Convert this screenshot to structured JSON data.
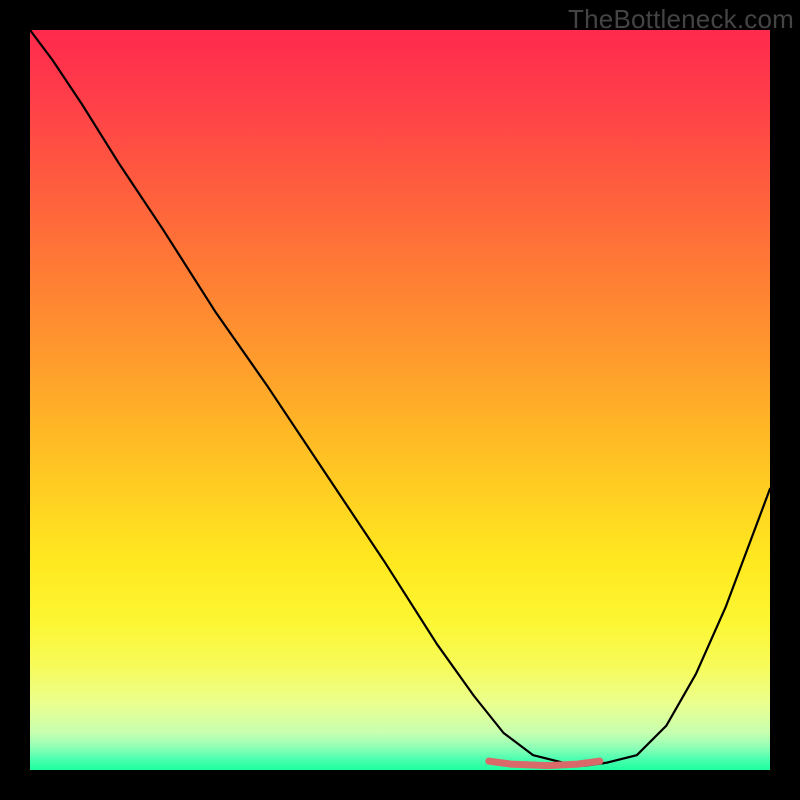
{
  "watermark": "TheBottleneck.com",
  "chart_data": {
    "type": "line",
    "title": "",
    "xlabel": "",
    "ylabel": "",
    "xlim": [
      0,
      100
    ],
    "ylim": [
      0,
      100
    ],
    "grid": false,
    "series": [
      {
        "name": "black-curve",
        "x": [
          0,
          3,
          7,
          12,
          18,
          25,
          32,
          40,
          48,
          55,
          60,
          64,
          68,
          72,
          75,
          78,
          82,
          86,
          90,
          94,
          97,
          100
        ],
        "y": [
          100,
          96,
          90,
          82,
          73,
          62,
          52,
          40,
          28,
          17,
          10,
          5,
          2,
          1,
          0.6,
          1,
          2,
          6,
          13,
          22,
          30,
          38
        ]
      },
      {
        "name": "red-floor-segment",
        "x": [
          62,
          65,
          70,
          74,
          77
        ],
        "y": [
          1.2,
          0.8,
          0.6,
          0.8,
          1.2
        ]
      }
    ],
    "colors": {
      "black_curve": "#000000",
      "floor_segment": "#d86a6a",
      "gradient_top": "#ff2a4d",
      "gradient_mid": "#ffd321",
      "gradient_bottom": "#1cff9e",
      "frame": "#000000"
    }
  }
}
